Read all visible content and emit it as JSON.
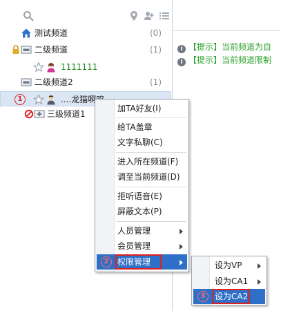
{
  "toolbar": {
    "icons": [
      "search-icon",
      "location-pin-icon",
      "user-add-icon",
      "list-icon"
    ]
  },
  "tree": {
    "root": {
      "label": "测试频道",
      "count": "(0)",
      "icon": "house-icon"
    },
    "channel_level2": {
      "label": "二级频道",
      "count": "(1)",
      "icon": "locked-folder-icon"
    },
    "member_1": {
      "name": "1111111",
      "icon": "female-user-icon"
    },
    "channel_level2b": {
      "label": "二级频道2",
      "count": "(1)",
      "icon": "folder-icon"
    },
    "selected_member": {
      "marker": "1",
      "name": "....龙猫啊呜",
      "icon": "male-user-icon"
    },
    "channel_level3": {
      "label": "三级频道1",
      "icon": "folder-icon"
    }
  },
  "messages": [
    {
      "tag": "【提示】",
      "text": "当前频道为自"
    },
    {
      "tag": "【提示】",
      "text": "当前频道限制"
    }
  ],
  "context_menu": {
    "items": [
      {
        "label": "加TA好友(I)"
      },
      {
        "label": "给TA盖章"
      },
      {
        "label": "文字私聊(C)"
      },
      {
        "label": "进入所在频道(F)"
      },
      {
        "label": "调至当前频道(D)"
      },
      {
        "label": "拒听语音(E)"
      },
      {
        "label": "屏蔽文本(P)"
      },
      {
        "label": "人员管理"
      },
      {
        "label": "会员管理"
      },
      {
        "label": "权限管理",
        "marker": "2"
      }
    ]
  },
  "submenu": {
    "items": [
      {
        "label": "设为VP"
      },
      {
        "label": "设为CA1"
      },
      {
        "label": "设为CA2",
        "marker": "3"
      }
    ]
  },
  "colors": {
    "accent": "#2e6fc7",
    "highlight_box": "#e02020",
    "hint_text": "#2aa02a",
    "selected_row": "#dbe6f4"
  }
}
